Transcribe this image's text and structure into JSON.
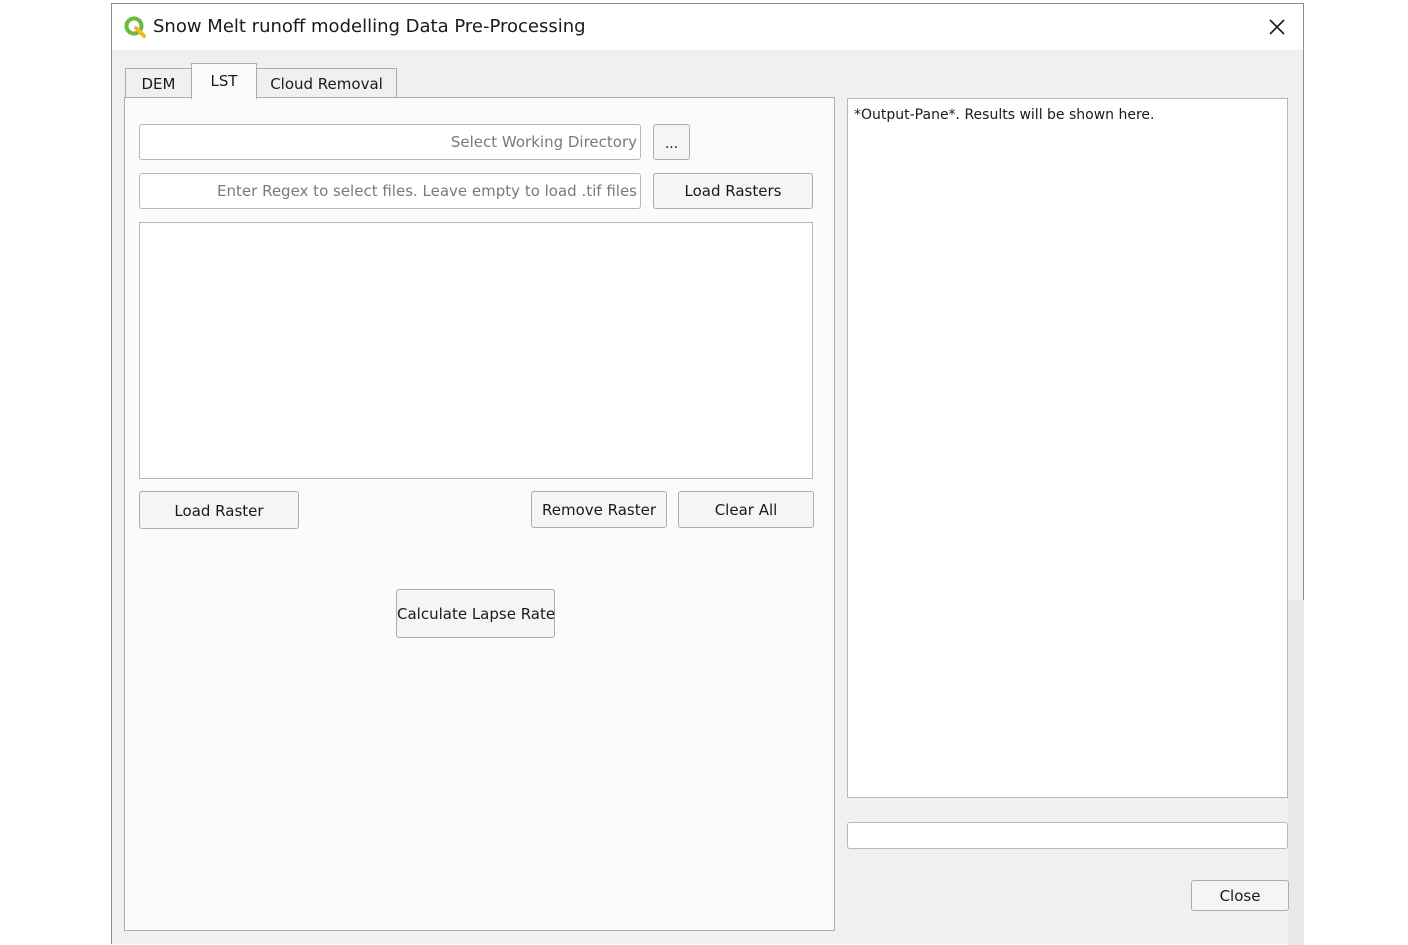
{
  "window": {
    "title": "Snow Melt runoff modelling Data Pre-Processing",
    "app_icon": "qgis-logo-icon",
    "close_icon": "close-icon"
  },
  "tabs": [
    {
      "label": "DEM",
      "active": false
    },
    {
      "label": "LST",
      "active": true
    },
    {
      "label": "Cloud Removal",
      "active": false
    }
  ],
  "lst": {
    "working_dir_placeholder": "Select Working Directory",
    "browse_label": "...",
    "regex_placeholder": "Enter Regex to select files. Leave empty to load .tif files",
    "load_rasters_label": "Load Rasters",
    "raster_list": [],
    "load_raster_label": "Load Raster",
    "remove_raster_label": "Remove Raster",
    "clear_all_label": "Clear All",
    "calculate_label": "Calculate Lapse Rate"
  },
  "output": {
    "text": "*Output-Pane*. Results will be shown here."
  },
  "progress": {
    "value": 0
  },
  "footer": {
    "close_label": "Close"
  },
  "colors": {
    "qgis_green": "#6cba3c",
    "qgis_yellow": "#f0b72a",
    "window_bg": "#f0f0f0",
    "panel_bg": "#fbfbfb"
  }
}
